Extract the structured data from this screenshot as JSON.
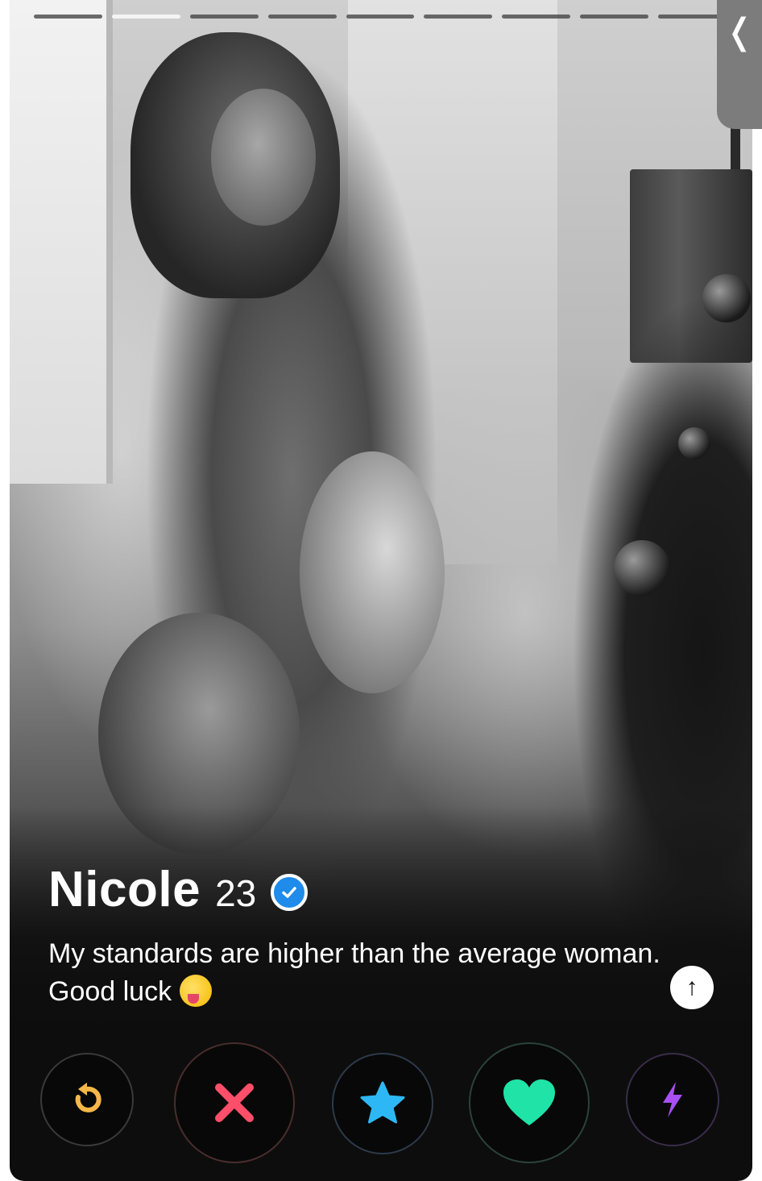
{
  "photo": {
    "total_photos": 9,
    "active_index": 1
  },
  "navigation": {
    "back_icon": "chevron-left-icon",
    "back_glyph": "❬"
  },
  "profile": {
    "name": "Nicole",
    "age": "23",
    "verified_icon": "verified-badge-icon",
    "bio": "My standards are higher than the average woman. Good luck",
    "bio_emoji_icon": "winking-tongue-emoji-icon"
  },
  "info_button": {
    "icon": "arrow-up-icon",
    "glyph": "↑"
  },
  "actions": [
    {
      "name": "rewind",
      "icon": "rewind-icon",
      "color": "#f5b748"
    },
    {
      "name": "nope",
      "icon": "close-icon",
      "color": "#fd4f6a"
    },
    {
      "name": "super_like",
      "icon": "star-icon",
      "color": "#2db8f5"
    },
    {
      "name": "like",
      "icon": "heart-icon",
      "color": "#20e3a7"
    },
    {
      "name": "boost",
      "icon": "lightning-icon",
      "color": "#a84ff5"
    }
  ]
}
